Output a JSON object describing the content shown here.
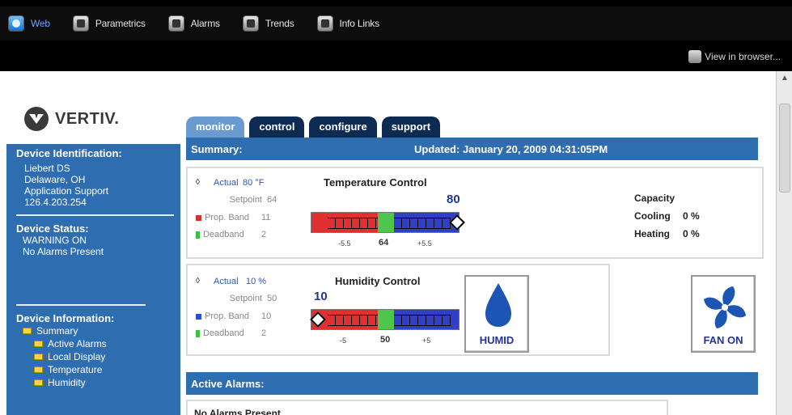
{
  "nav": {
    "items": [
      {
        "label": "Web",
        "icon": "web-icon",
        "active": true
      },
      {
        "label": "Parametrics",
        "icon": "parametrics-icon"
      },
      {
        "label": "Alarms",
        "icon": "alarms-icon"
      },
      {
        "label": "Trends",
        "icon": "trends-icon"
      },
      {
        "label": "Info Links",
        "icon": "info-links-icon"
      }
    ],
    "view_in_browser": "View in browser..."
  },
  "logo": {
    "text": "VERTIV."
  },
  "sidebar": {
    "device_identification": {
      "title": "Device Identification:",
      "lines": [
        "Liebert DS",
        "Delaware, OH",
        "Application Support",
        "126.4.203.254"
      ]
    },
    "device_status": {
      "title": "Device Status:",
      "lines": [
        "WARNING ON",
        "No Alarms Present"
      ]
    },
    "device_information": {
      "title": "Device Information:",
      "items": [
        "Summary",
        "Active Alarms",
        "Local Display",
        "Temperature",
        "Humidity"
      ]
    }
  },
  "tabs": [
    "monitor",
    "control",
    "configure",
    "support"
  ],
  "summary": {
    "label": "Summary:",
    "updated": "Updated: January 20, 2009 04:31:05PM"
  },
  "temperature": {
    "title": "Temperature Control",
    "actual_label": "Actual",
    "actual_value": "80 °F",
    "setpoint_label": "Setpoint",
    "setpoint_value": "64",
    "prop_band_label": "Prop. Band",
    "prop_band_value": "11",
    "deadband_label": "Deadband",
    "deadband_value": "2",
    "gauge_value": "80",
    "tick_low": "-5.5",
    "tick_mid": "64",
    "tick_high": "+5.5"
  },
  "capacity": {
    "title": "Capacity",
    "cooling_label": "Cooling",
    "cooling_value": "0 %",
    "heating_label": "Heating",
    "heating_value": "0 %"
  },
  "humidity": {
    "title": "Humidity Control",
    "actual_label": "Actual",
    "actual_value": "10 %",
    "setpoint_label": "Setpoint",
    "setpoint_value": "50",
    "prop_band_label": "Prop. Band",
    "prop_band_value": "10",
    "deadband_label": "Deadband",
    "deadband_value": "2",
    "gauge_value": "10",
    "tick_low": "-5",
    "tick_mid": "50",
    "tick_high": "+5"
  },
  "humid_button": {
    "label": "HUMID",
    "icon": "water-drop-icon"
  },
  "fan_button": {
    "label": "FAN ON",
    "icon": "fan-icon"
  },
  "alarms": {
    "title": "Active Alarms:",
    "message": "No Alarms Present"
  },
  "colors": {
    "header_blue": "#2e6db0",
    "tab_dark": "#0d2a52",
    "gauge_red": "#e03030",
    "gauge_green": "#4cc64c",
    "gauge_blue": "#2f3fc8"
  }
}
